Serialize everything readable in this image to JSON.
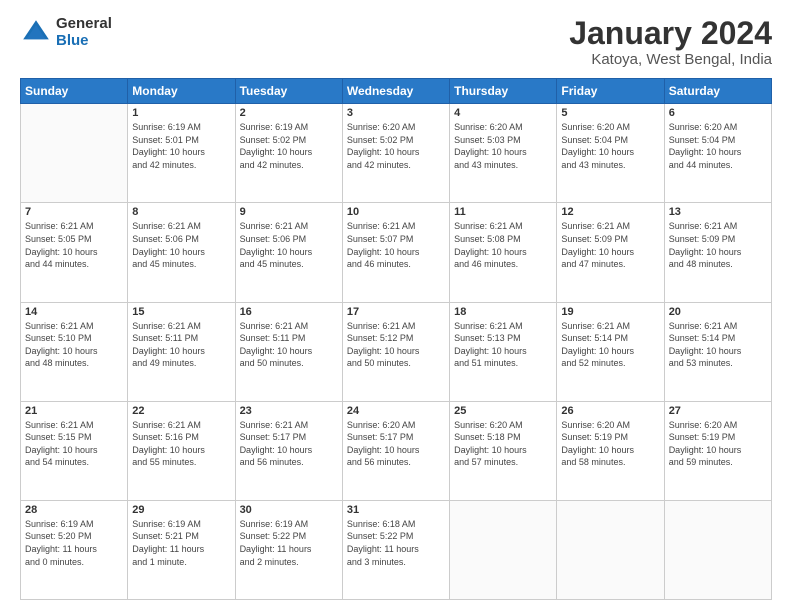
{
  "logo": {
    "general": "General",
    "blue": "Blue"
  },
  "title": "January 2024",
  "subtitle": "Katoya, West Bengal, India",
  "headers": [
    "Sunday",
    "Monday",
    "Tuesday",
    "Wednesday",
    "Thursday",
    "Friday",
    "Saturday"
  ],
  "weeks": [
    [
      {
        "num": "",
        "info": ""
      },
      {
        "num": "1",
        "info": "Sunrise: 6:19 AM\nSunset: 5:01 PM\nDaylight: 10 hours\nand 42 minutes."
      },
      {
        "num": "2",
        "info": "Sunrise: 6:19 AM\nSunset: 5:02 PM\nDaylight: 10 hours\nand 42 minutes."
      },
      {
        "num": "3",
        "info": "Sunrise: 6:20 AM\nSunset: 5:02 PM\nDaylight: 10 hours\nand 42 minutes."
      },
      {
        "num": "4",
        "info": "Sunrise: 6:20 AM\nSunset: 5:03 PM\nDaylight: 10 hours\nand 43 minutes."
      },
      {
        "num": "5",
        "info": "Sunrise: 6:20 AM\nSunset: 5:04 PM\nDaylight: 10 hours\nand 43 minutes."
      },
      {
        "num": "6",
        "info": "Sunrise: 6:20 AM\nSunset: 5:04 PM\nDaylight: 10 hours\nand 44 minutes."
      }
    ],
    [
      {
        "num": "7",
        "info": "Sunrise: 6:21 AM\nSunset: 5:05 PM\nDaylight: 10 hours\nand 44 minutes."
      },
      {
        "num": "8",
        "info": "Sunrise: 6:21 AM\nSunset: 5:06 PM\nDaylight: 10 hours\nand 45 minutes."
      },
      {
        "num": "9",
        "info": "Sunrise: 6:21 AM\nSunset: 5:06 PM\nDaylight: 10 hours\nand 45 minutes."
      },
      {
        "num": "10",
        "info": "Sunrise: 6:21 AM\nSunset: 5:07 PM\nDaylight: 10 hours\nand 46 minutes."
      },
      {
        "num": "11",
        "info": "Sunrise: 6:21 AM\nSunset: 5:08 PM\nDaylight: 10 hours\nand 46 minutes."
      },
      {
        "num": "12",
        "info": "Sunrise: 6:21 AM\nSunset: 5:09 PM\nDaylight: 10 hours\nand 47 minutes."
      },
      {
        "num": "13",
        "info": "Sunrise: 6:21 AM\nSunset: 5:09 PM\nDaylight: 10 hours\nand 48 minutes."
      }
    ],
    [
      {
        "num": "14",
        "info": "Sunrise: 6:21 AM\nSunset: 5:10 PM\nDaylight: 10 hours\nand 48 minutes."
      },
      {
        "num": "15",
        "info": "Sunrise: 6:21 AM\nSunset: 5:11 PM\nDaylight: 10 hours\nand 49 minutes."
      },
      {
        "num": "16",
        "info": "Sunrise: 6:21 AM\nSunset: 5:11 PM\nDaylight: 10 hours\nand 50 minutes."
      },
      {
        "num": "17",
        "info": "Sunrise: 6:21 AM\nSunset: 5:12 PM\nDaylight: 10 hours\nand 50 minutes."
      },
      {
        "num": "18",
        "info": "Sunrise: 6:21 AM\nSunset: 5:13 PM\nDaylight: 10 hours\nand 51 minutes."
      },
      {
        "num": "19",
        "info": "Sunrise: 6:21 AM\nSunset: 5:14 PM\nDaylight: 10 hours\nand 52 minutes."
      },
      {
        "num": "20",
        "info": "Sunrise: 6:21 AM\nSunset: 5:14 PM\nDaylight: 10 hours\nand 53 minutes."
      }
    ],
    [
      {
        "num": "21",
        "info": "Sunrise: 6:21 AM\nSunset: 5:15 PM\nDaylight: 10 hours\nand 54 minutes."
      },
      {
        "num": "22",
        "info": "Sunrise: 6:21 AM\nSunset: 5:16 PM\nDaylight: 10 hours\nand 55 minutes."
      },
      {
        "num": "23",
        "info": "Sunrise: 6:21 AM\nSunset: 5:17 PM\nDaylight: 10 hours\nand 56 minutes."
      },
      {
        "num": "24",
        "info": "Sunrise: 6:20 AM\nSunset: 5:17 PM\nDaylight: 10 hours\nand 56 minutes."
      },
      {
        "num": "25",
        "info": "Sunrise: 6:20 AM\nSunset: 5:18 PM\nDaylight: 10 hours\nand 57 minutes."
      },
      {
        "num": "26",
        "info": "Sunrise: 6:20 AM\nSunset: 5:19 PM\nDaylight: 10 hours\nand 58 minutes."
      },
      {
        "num": "27",
        "info": "Sunrise: 6:20 AM\nSunset: 5:19 PM\nDaylight: 10 hours\nand 59 minutes."
      }
    ],
    [
      {
        "num": "28",
        "info": "Sunrise: 6:19 AM\nSunset: 5:20 PM\nDaylight: 11 hours\nand 0 minutes."
      },
      {
        "num": "29",
        "info": "Sunrise: 6:19 AM\nSunset: 5:21 PM\nDaylight: 11 hours\nand 1 minute."
      },
      {
        "num": "30",
        "info": "Sunrise: 6:19 AM\nSunset: 5:22 PM\nDaylight: 11 hours\nand 2 minutes."
      },
      {
        "num": "31",
        "info": "Sunrise: 6:18 AM\nSunset: 5:22 PM\nDaylight: 11 hours\nand 3 minutes."
      },
      {
        "num": "",
        "info": ""
      },
      {
        "num": "",
        "info": ""
      },
      {
        "num": "",
        "info": ""
      }
    ]
  ]
}
